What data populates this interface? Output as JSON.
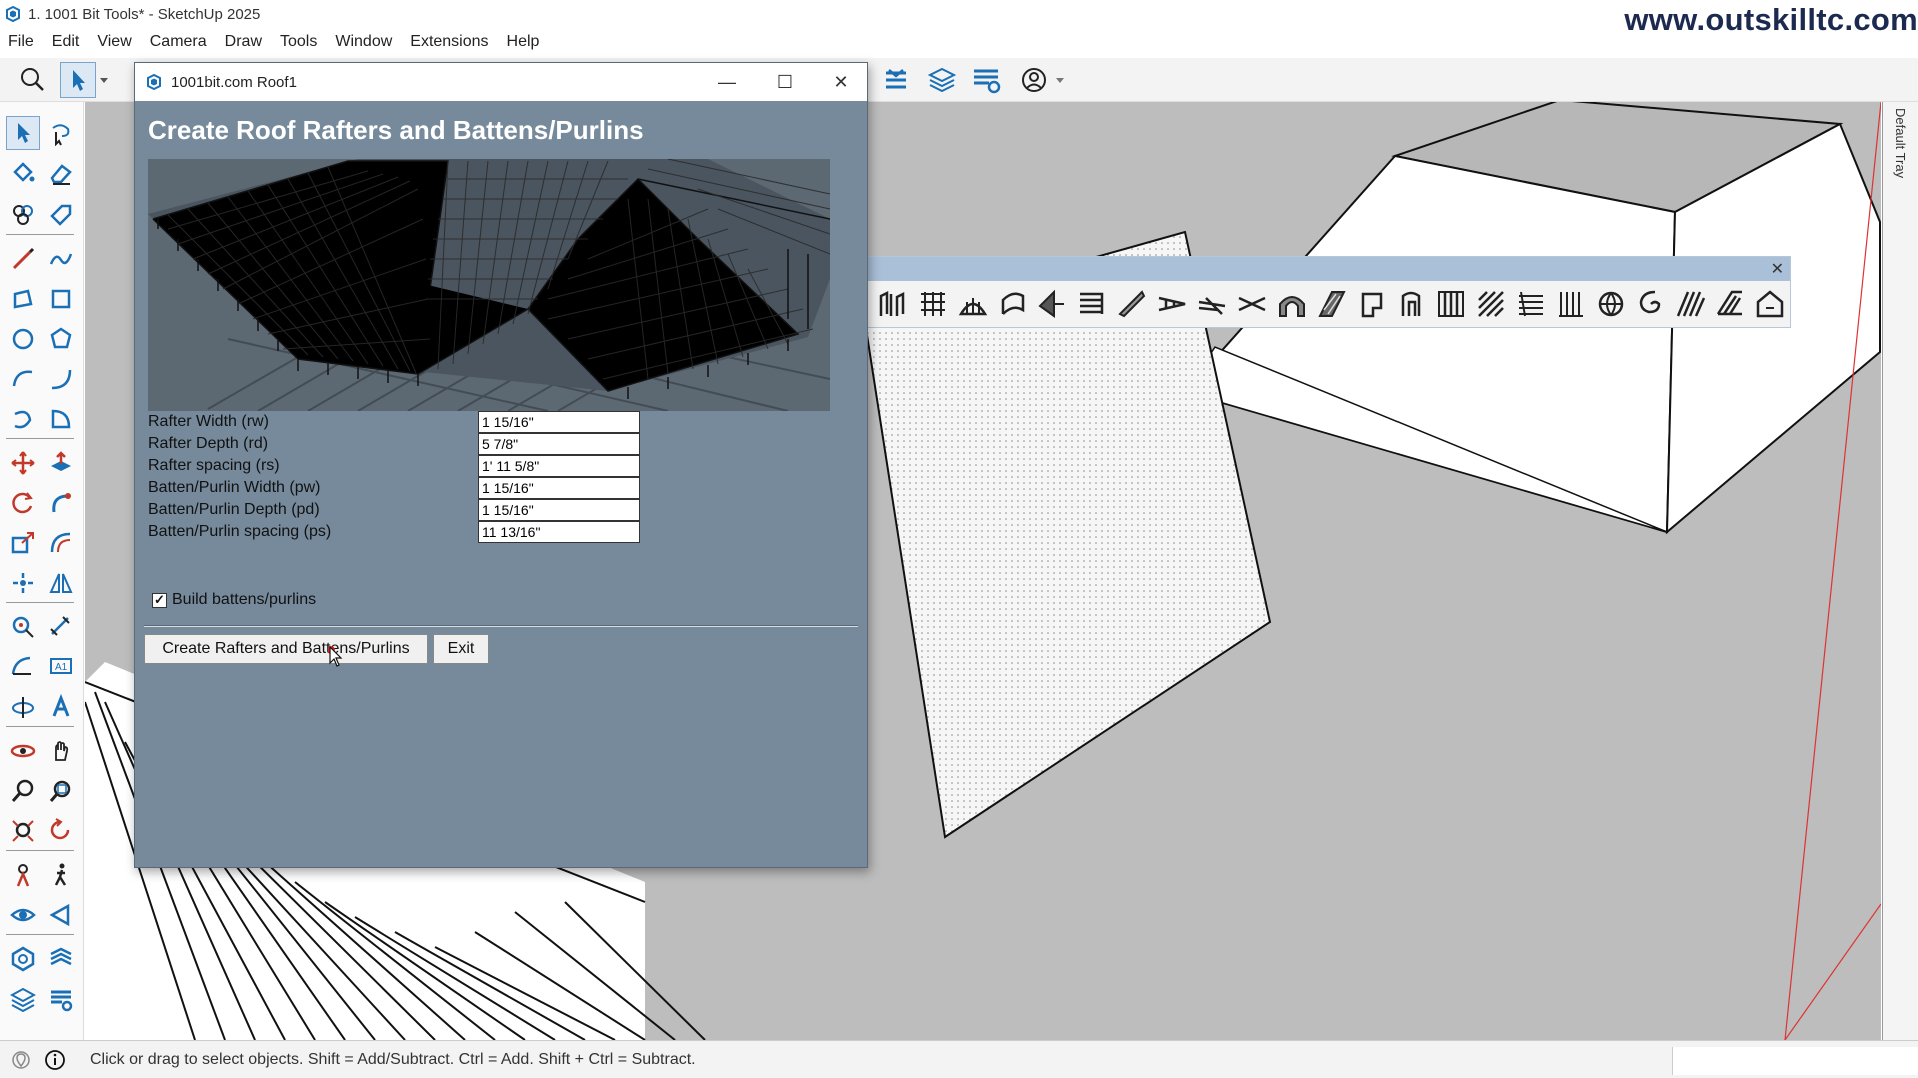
{
  "window": {
    "title": "1. 1001 Bit Tools* - SketchUp 2025",
    "watermark": "www.outskilltc.com"
  },
  "menu": [
    "File",
    "Edit",
    "View",
    "Camera",
    "Draw",
    "Tools",
    "Window",
    "Extensions",
    "Help"
  ],
  "tray": {
    "label": "Default Tray"
  },
  "status": {
    "text": "Click or drag to select objects. Shift = Add/Subtract. Ctrl = Add. Shift + Ctrl = Subtract."
  },
  "dialog": {
    "title": "1001bit.com Roof1",
    "heading": "Create Roof Rafters and Battens/Purlins",
    "fields": [
      {
        "label": "Rafter Width (rw)",
        "value": "1 15/16\""
      },
      {
        "label": "Rafter Depth (rd)",
        "value": "5 7/8\""
      },
      {
        "label": "Rafter spacing (rs)",
        "value": "1' 11 5/8\""
      },
      {
        "label": "Batten/Purlin Width (pw)",
        "value": "1 15/16\""
      },
      {
        "label": "Batten/Purlin Depth (pd)",
        "value": "1 15/16\""
      },
      {
        "label": "Batten/Purlin spacing (ps)",
        "value": "11 13/16\""
      }
    ],
    "checkbox": {
      "label": "Build battens/purlins",
      "checked": true
    },
    "buttons": {
      "create": "Create Rafters and Battens/Purlins",
      "exit": "Exit"
    }
  },
  "colors": {
    "dialog_bg": "#768a9c",
    "viewport_bg": "#bdbdbd",
    "float_header": "#a9c0d8",
    "accent_blue": "#1a6fb5"
  }
}
